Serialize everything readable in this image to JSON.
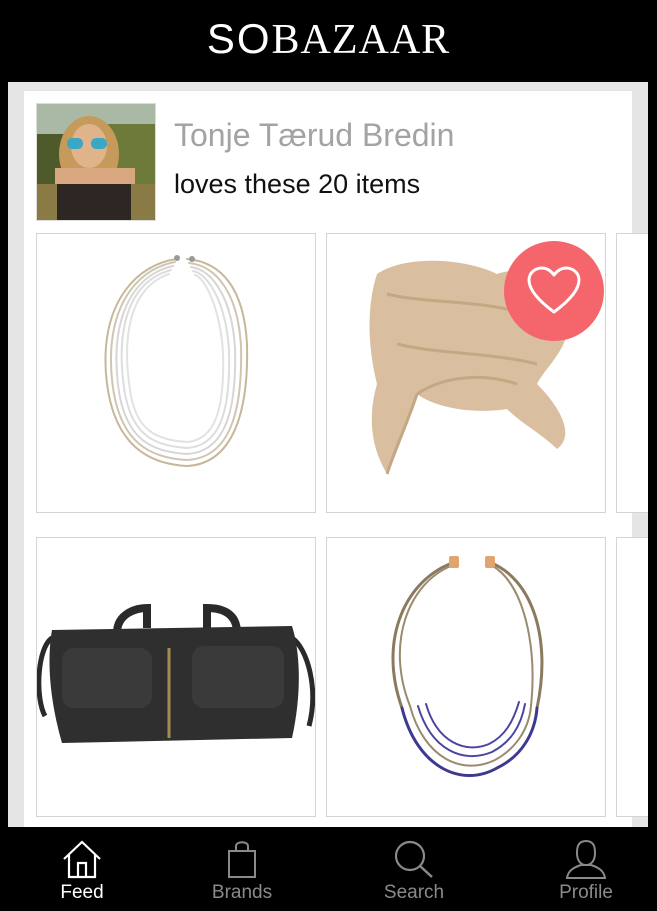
{
  "header": {
    "logo_so": "SO",
    "logo_bazaar": "BAZAAR"
  },
  "activity": {
    "user_name": "Tonje Tærud Bredin",
    "subtitle": "loves these 20 items"
  },
  "items": [
    {
      "name": "necklace-silver-icon"
    },
    {
      "name": "scarf-beige-icon",
      "liked": true
    },
    {
      "name": "bag-black-icon"
    },
    {
      "name": "necklace-blue-icon"
    }
  ],
  "colors": {
    "like": "#f5666c",
    "active_tab": "#ffffff",
    "inactive_tab": "#8a8a8a"
  },
  "tabs": [
    {
      "label": "Feed",
      "icon": "home-icon",
      "active": true
    },
    {
      "label": "Brands",
      "icon": "shopping-bag-icon",
      "active": false
    },
    {
      "label": "Search",
      "icon": "search-icon",
      "active": false
    },
    {
      "label": "Profile",
      "icon": "person-icon",
      "active": false
    }
  ]
}
